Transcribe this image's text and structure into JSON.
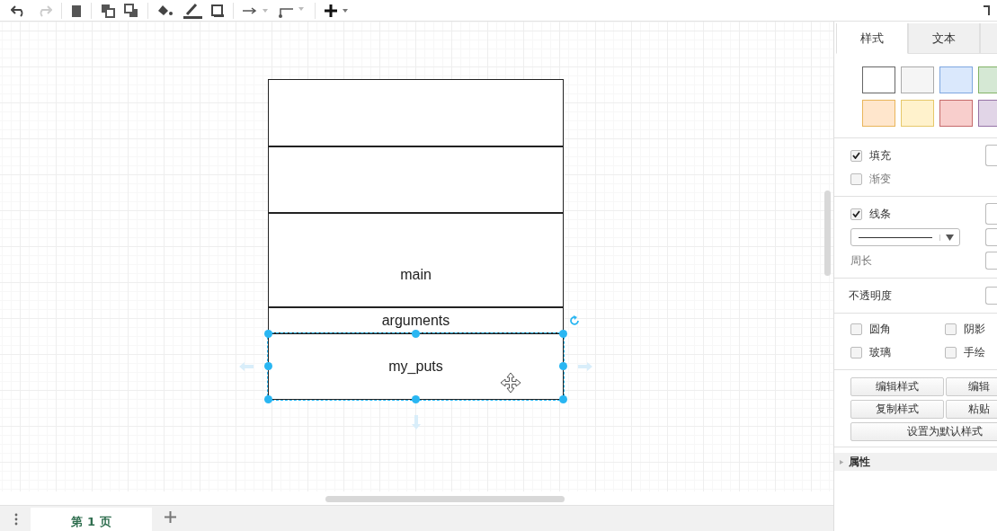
{
  "diagram": {
    "shapes": [
      {
        "selected": false
      },
      {
        "selected": false
      },
      {
        "label": "main",
        "selected": false
      },
      {
        "label": "arguments",
        "selected": false
      },
      {
        "label": "my_puts",
        "selected": true
      }
    ]
  },
  "format_panel": {
    "tabs": [
      {
        "label": "样式",
        "selected": true
      },
      {
        "label": "文本",
        "selected": false
      }
    ],
    "swatches": [
      {
        "color": "#ffffff"
      },
      {
        "color": "#f5f5f5"
      },
      {
        "color": "#dae8fc"
      },
      {
        "color": "#d5e8d4"
      },
      {
        "color": "#ffe6cc"
      },
      {
        "color": "#fff2cc"
      },
      {
        "color": "#f8cecc"
      },
      {
        "color": "#e1d5e7"
      }
    ],
    "fill": {
      "label": "填充",
      "checked": true
    },
    "gradient": {
      "label": "渐变",
      "checked": false
    },
    "line": {
      "label": "线条",
      "checked": true
    },
    "perimeter_label": "周长",
    "opacity_label": "不透明度",
    "options": [
      {
        "label": "圆角",
        "checked": false
      },
      {
        "label": "阴影",
        "checked": false
      },
      {
        "label": "玻璃",
        "checked": false
      },
      {
        "label": "手绘",
        "checked": false
      }
    ],
    "buttons": [
      "编辑样式",
      "编辑",
      "复制样式",
      "粘贴"
    ],
    "default_button": "设置为默认样式",
    "properties": {
      "label": "属性",
      "expanded": false
    }
  },
  "page_tabs": [
    {
      "label": "第 1 页",
      "selected": true
    }
  ]
}
